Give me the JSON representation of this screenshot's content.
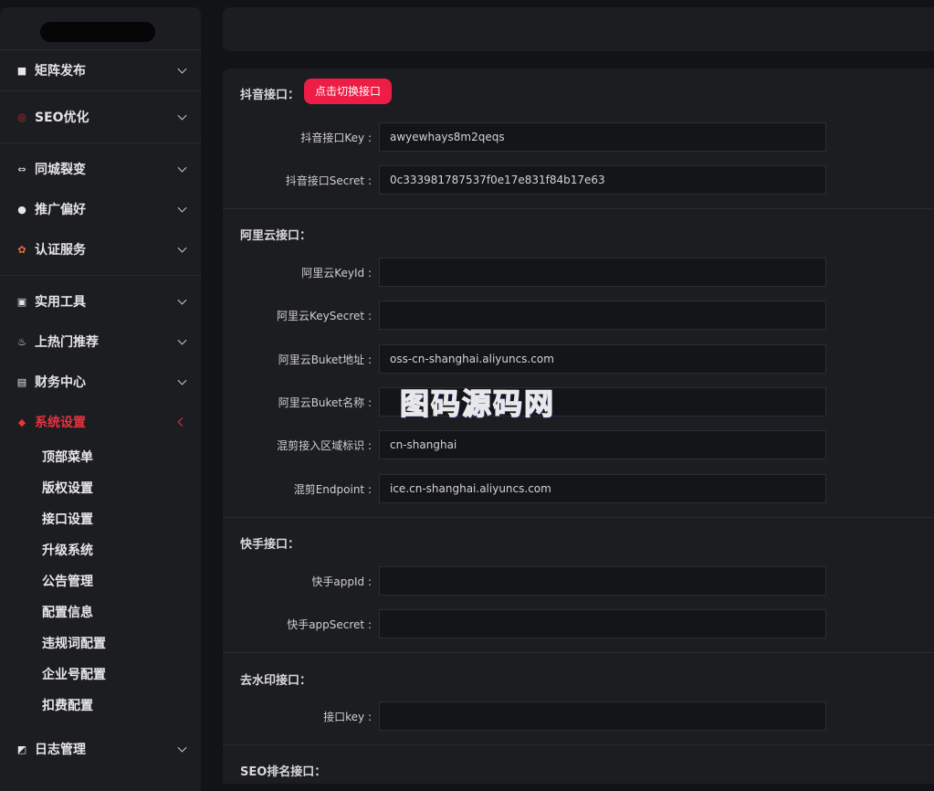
{
  "sidebar": {
    "groups": [
      {
        "items": [
          {
            "label": "矩阵发布",
            "icon": "video-icon"
          }
        ]
      },
      {
        "items": [
          {
            "label": "SEO优化",
            "icon": "seo-icon"
          }
        ]
      },
      {
        "items": [
          {
            "label": "同城裂变",
            "icon": "link-icon"
          },
          {
            "label": "推广偏好",
            "icon": "robot-icon"
          },
          {
            "label": "认证服务",
            "icon": "badge-icon"
          }
        ]
      },
      {
        "items": [
          {
            "label": "实用工具",
            "icon": "toolbox-icon"
          },
          {
            "label": "上热门推荐",
            "icon": "fire-icon"
          },
          {
            "label": "财务中心",
            "icon": "wallet-icon"
          },
          {
            "label": "系统设置",
            "icon": "settings-icon",
            "active": true
          }
        ]
      }
    ],
    "submenu": [
      "顶部菜单",
      "版权设置",
      "接口设置",
      "升级系统",
      "公告管理",
      "配置信息",
      "违规词配置",
      "企业号配置",
      "扣费配置"
    ],
    "footer_item": {
      "label": "日志管理",
      "icon": "log-icon"
    }
  },
  "form": {
    "douyin": {
      "title": "抖音接口：",
      "switch_label": "点击切换接口",
      "fields": [
        {
          "label": "抖音接口Key :",
          "value": "awyewhays8m2qeqs"
        },
        {
          "label": "抖音接口Secret :",
          "value": "0c333981787537f0e17e831f84b17e63"
        }
      ]
    },
    "aliyun": {
      "title": "阿里云接口：",
      "fields": [
        {
          "label": "阿里云KeyId :",
          "value": ""
        },
        {
          "label": "阿里云KeySecret :",
          "value": ""
        },
        {
          "label": "阿里云Buket地址 :",
          "value": "oss-cn-shanghai.aliyuncs.com"
        },
        {
          "label": "阿里云Buket名称 :",
          "value": ""
        },
        {
          "label": "混剪接入区域标识 :",
          "value": "cn-shanghai"
        },
        {
          "label": "混剪Endpoint :",
          "value": "ice.cn-shanghai.aliyuncs.com"
        }
      ]
    },
    "kuaishou": {
      "title": "快手接口：",
      "fields": [
        {
          "label": "快手appId :",
          "value": ""
        },
        {
          "label": "快手appSecret :",
          "value": ""
        }
      ]
    },
    "watermark_api": {
      "title": "去水印接口：",
      "fields": [
        {
          "label": "接口key :",
          "value": ""
        }
      ]
    },
    "seo_rank": {
      "title": "SEO排名接口："
    }
  },
  "overlay": {
    "watermark_text": "图码源码网"
  },
  "colors": {
    "accent": "#ee1d46",
    "active_text": "#e8323f",
    "background": "#121316",
    "panel": "#1c1d21"
  }
}
